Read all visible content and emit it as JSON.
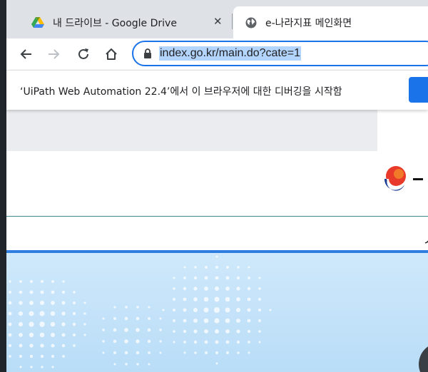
{
  "browser": {
    "tabs": [
      {
        "title": "내 드라이브 - Google Drive",
        "active": false,
        "icon": "google-drive-icon"
      },
      {
        "title": "e-나라지표 메인화면",
        "active": true,
        "icon": "globe-icon"
      }
    ],
    "close_glyph": "✕",
    "toolbar": {
      "back_icon": "arrow-left-icon",
      "forward_icon": "arrow-right-icon",
      "reload_icon": "reload-icon",
      "home_icon": "home-icon"
    },
    "address_bar": {
      "url": "index.go.kr/main.do?cate=1",
      "selected": true,
      "secure_icon": "lock-icon"
    }
  },
  "infobar": {
    "message": "‘UiPath Web Automation 22.4’에서 이 브라우저에 대한 디버깅을 시작함",
    "button_color": "#1a73e8"
  },
  "page": {
    "accent_color": "#2e7de0",
    "nav_partial_glyph": "ㅅ"
  }
}
